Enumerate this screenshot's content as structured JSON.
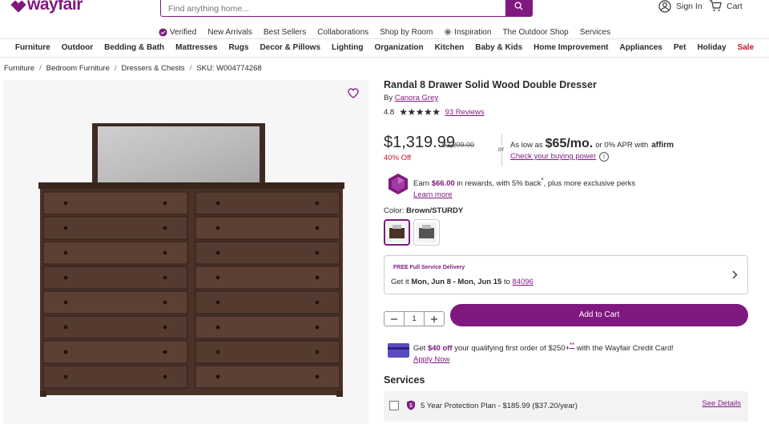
{
  "header": {
    "logo": "wayfair",
    "search_placeholder": "Find anything home...",
    "sign_in": "Sign In",
    "cart": "Cart"
  },
  "nav_primary": [
    {
      "label": "Verified",
      "icon": "verified-badge-icon"
    },
    {
      "label": "New Arrivals"
    },
    {
      "label": "Best Sellers"
    },
    {
      "label": "Collaborations"
    },
    {
      "label": "Shop by Room"
    },
    {
      "label": "Inspiration",
      "icon": "sparkle-icon"
    },
    {
      "label": "The Outdoor Shop"
    },
    {
      "label": "Services"
    }
  ],
  "nav_categories": [
    "Furniture",
    "Outdoor",
    "Bedding & Bath",
    "Mattresses",
    "Rugs",
    "Decor & Pillows",
    "Lighting",
    "Organization",
    "Kitchen",
    "Baby & Kids",
    "Home Improvement",
    "Appliances",
    "Pet",
    "Holiday",
    "Sale"
  ],
  "breadcrumbs": [
    "Furniture",
    "Bedroom Furniture",
    "Dressers & Chests",
    "SKU: W004774268"
  ],
  "product": {
    "title": "Randal 8 Drawer Solid Wood Double Dresser",
    "by_prefix": "By",
    "brand": "Canora Grey",
    "rating": "4.8",
    "stars": 5,
    "reviews": "93 Reviews",
    "price": "$1,319.99",
    "was_price": "$2,209.00",
    "discount": "40% Off",
    "or": "or",
    "affirm_prefix": "As low as",
    "affirm_amount": "$65/mo.",
    "affirm_suffix": "or 0% APR with",
    "affirm_logo": "affirm",
    "check_power": "Check your buying power",
    "rewards_earn": "Earn",
    "rewards_amount": "$66.00",
    "rewards_text": "in rewards, with 5% back",
    "rewards_mark": "*",
    "rewards_suffix": ", plus more exclusive perks",
    "learn_more": "Learn more",
    "color_label": "Color:",
    "color_value": "Brown/STURDY",
    "delivery_free": "FREE Full Service Delivery",
    "delivery_get": "Get it",
    "delivery_dates": "Mon, Jun 8 - Mon, Jun 15",
    "delivery_to": "to",
    "delivery_zip": "84096",
    "quantity": "1",
    "add_to_cart": "Add to Cart",
    "credit_get": "Get",
    "credit_amount": "$40 off",
    "credit_text": "your qualifying first order of $250+",
    "credit_mark": "**",
    "credit_suffix": "with the Wayfair Credit Card!",
    "apply_now": "Apply Now",
    "services_heading": "Services",
    "service_plan": "5 Year Protection Plan - $185.99 ($37.20/year)",
    "see_details": "See Details"
  },
  "colors": {
    "brand": "#7f187f",
    "sale": "#c5142c"
  }
}
